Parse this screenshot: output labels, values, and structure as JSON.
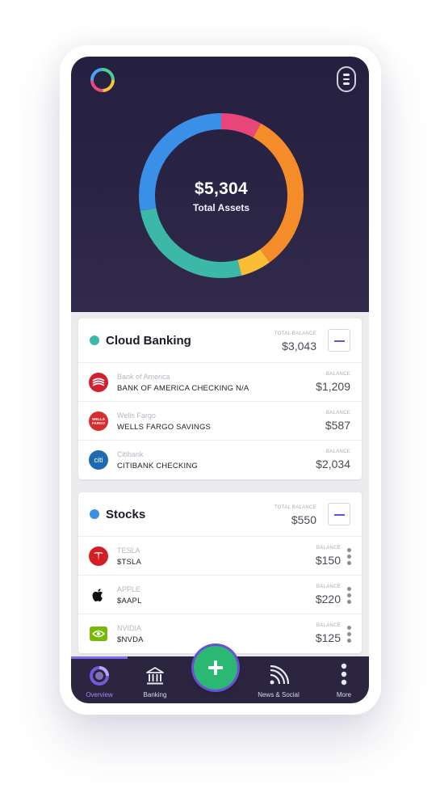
{
  "summary": {
    "total_amount": "$5,304",
    "total_label": "Total Assets"
  },
  "donut_segments": [
    {
      "name": "pink",
      "value": 8,
      "color": "#e8457a"
    },
    {
      "name": "orange",
      "value": 32,
      "color": "#f48c2a"
    },
    {
      "name": "yellow",
      "value": 6,
      "color": "#fbbd35"
    },
    {
      "name": "teal",
      "value": 26,
      "color": "#3cb8a8"
    },
    {
      "name": "blue",
      "value": 28,
      "color": "#3a8fe6"
    }
  ],
  "cloud_banking": {
    "title": "Cloud Banking",
    "dot_color": "#3cb8a8",
    "total_label": "TOTAL BALANCE",
    "total_value": "$3,043",
    "accounts": [
      {
        "bank": "Bank of America",
        "name": "BANK OF AMERICA CHECKING N/A",
        "balance_label": "BALANCE",
        "balance": "$1,209",
        "icon": "bank-of-america-icon",
        "icon_color": "#d2202f",
        "icon_text": ""
      },
      {
        "bank": "Wells Fargo",
        "name": "WELLS FARGO SAVINGS",
        "balance_label": "BALANCE",
        "balance": "$587",
        "icon": "wells-fargo-icon",
        "icon_color": "#d42e2e",
        "icon_text": "WELLS FARGO"
      },
      {
        "bank": "Citibank",
        "name": "CITIBANK CHECKING",
        "balance_label": "BALANCE",
        "balance": "$2,034",
        "icon": "citibank-icon",
        "icon_color": "#1e6ab0",
        "icon_text": "citi"
      }
    ]
  },
  "stocks": {
    "title": "Stocks",
    "dot_color": "#3a8fe6",
    "total_label": "TOTAL BALANCE",
    "total_value": "$550",
    "holdings": [
      {
        "company": "TESLA",
        "ticker": "$TSLA",
        "balance_label": "BALANCE",
        "balance": "$150",
        "icon": "tesla-icon",
        "icon_color": "#d21f26"
      },
      {
        "company": "APPLE",
        "ticker": "$AAPL",
        "balance_label": "BALANCE",
        "balance": "$220",
        "icon": "apple-icon",
        "icon_color": "#111111"
      },
      {
        "company": "NVIDIA",
        "ticker": "$NVDA",
        "balance_label": "BALANCE",
        "balance": "$125",
        "icon": "nvidia-icon",
        "icon_color": "#76b900"
      }
    ]
  },
  "tabs": {
    "overview": "Overview",
    "banking": "Banking",
    "news": "News & Social",
    "more": "More"
  },
  "colors": {
    "accent": "#7c6cf0",
    "fab": "#2ab873",
    "hero_bg": "#27213f"
  }
}
